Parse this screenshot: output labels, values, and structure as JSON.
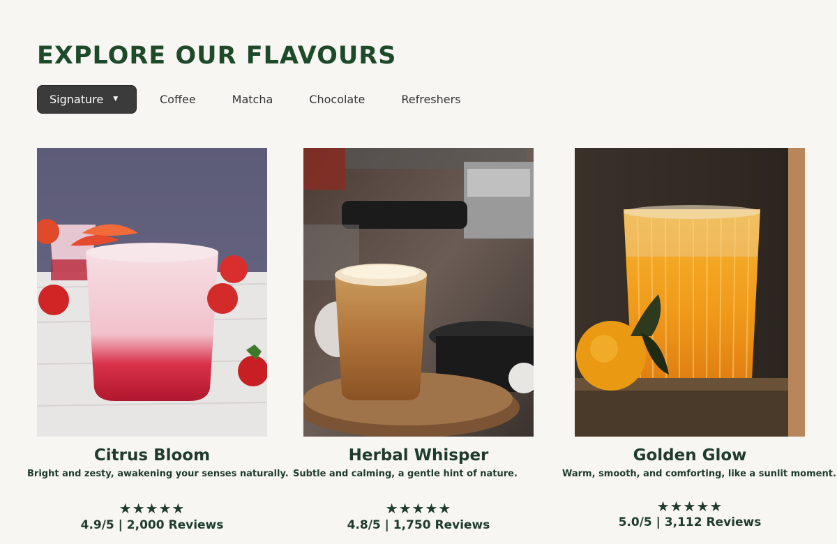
{
  "header": {
    "title": "EXPLORE OUR FLAVOURS"
  },
  "tabs": [
    {
      "label": "Signature",
      "active": true
    },
    {
      "label": "Coffee"
    },
    {
      "label": "Matcha"
    },
    {
      "label": "Chocolate"
    },
    {
      "label": "Refreshers"
    }
  ],
  "products": [
    {
      "name": "Citrus Bloom",
      "description": "Bright and zesty, awakening your senses naturally.",
      "stars": "★★★★★",
      "rating": "4.9/5 | 2,000 Reviews",
      "image": "strawberry-drink-photo"
    },
    {
      "name": "Herbal Whisper",
      "description": "Subtle and calming, a gentle hint of nature.",
      "stars": "★★★★★",
      "rating": "4.8/5 | 1,750 Reviews",
      "image": "espresso-latte-photo"
    },
    {
      "name": "Golden Glow",
      "description": "Warm, smooth, and comforting, like a sunlit moment.",
      "stars": "★★★★★",
      "rating": "5.0/5 | 3,112 Reviews",
      "image": "orange-juice-photo"
    }
  ],
  "colors": {
    "brand_green": "#1e4a2a",
    "background": "#f7f6f2",
    "active_tab": "#3b3b3b"
  }
}
